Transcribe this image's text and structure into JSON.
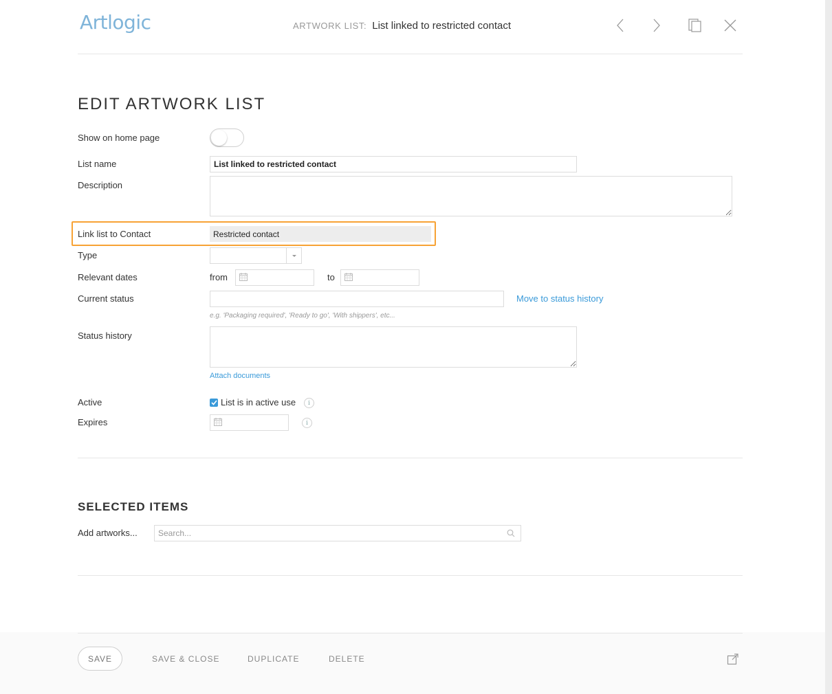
{
  "app": {
    "logo_text": "Artlogic",
    "brand_color": "#7fb4d9",
    "accent_color": "#3a9ad9",
    "highlight_color": "#f7a234"
  },
  "header": {
    "title_prefix": "ARTWORK LIST:",
    "title": "List linked to restricted contact",
    "icons": [
      "chevron-left-icon",
      "chevron-right-icon",
      "copy-icon",
      "close-icon"
    ]
  },
  "form": {
    "heading": "EDIT ARTWORK LIST",
    "show_on_home": {
      "label": "Show on home page",
      "value": false
    },
    "list_name": {
      "label": "List name",
      "value": "List linked to restricted contact"
    },
    "description": {
      "label": "Description",
      "value": ""
    },
    "link_contact": {
      "label": "Link list to Contact",
      "value": "Restricted contact"
    },
    "type": {
      "label": "Type",
      "value": ""
    },
    "relevant_dates": {
      "label": "Relevant dates",
      "from_label": "from",
      "to_label": "to",
      "from_value": "",
      "to_value": ""
    },
    "current_status": {
      "label": "Current status",
      "value": "",
      "move_link": "Move to status history",
      "hint": "e.g. 'Packaging required', 'Ready to go', 'With shippers', etc..."
    },
    "status_history": {
      "label": "Status history",
      "value": "",
      "attach_link": "Attach documents"
    },
    "active": {
      "label": "Active",
      "checkbox_label": "List is in active use",
      "checked": true
    },
    "expires": {
      "label": "Expires",
      "value": ""
    }
  },
  "selected_items": {
    "heading": "SELECTED ITEMS",
    "add_label": "Add artworks...",
    "search_placeholder": "Search..."
  },
  "footer": {
    "save": "SAVE",
    "save_close": "SAVE & CLOSE",
    "duplicate": "DUPLICATE",
    "delete": "DELETE"
  }
}
